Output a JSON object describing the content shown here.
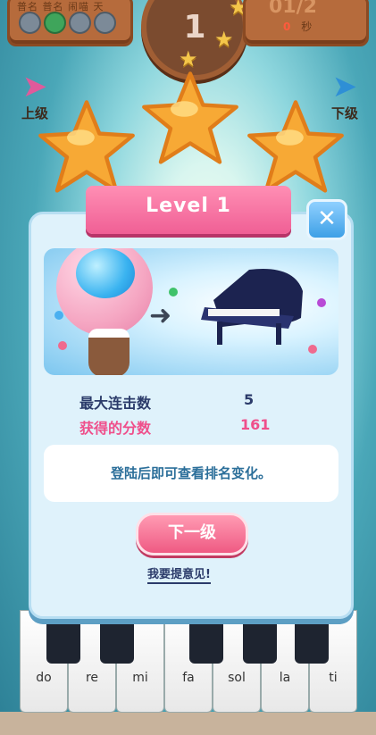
{
  "hud": {
    "names_text": "普名 普名 闹喵 天",
    "level_number": "1",
    "progress": "01/2",
    "timer_value": "0",
    "timer_unit": "秒"
  },
  "nav": {
    "prev_label": "上级",
    "next_label": "下级"
  },
  "stars_earned": 3,
  "dialog": {
    "title": "Level 1",
    "close_symbol": "✕",
    "stats": [
      {
        "label": "最大连击数",
        "value": "5"
      },
      {
        "label": "获得的分数",
        "value": "161"
      }
    ],
    "message": "登陆后即可查看排名变化。",
    "next_button": "下一级",
    "feedback_link": "我要提意见!"
  },
  "piano_keys": [
    "do",
    "re",
    "mi",
    "fa",
    "sol",
    "la",
    "ti"
  ],
  "colors": {
    "ribbon": "#f05f95",
    "score": "#ef4f8b",
    "button": "#ef5a83",
    "close": "#3ea0e6"
  }
}
